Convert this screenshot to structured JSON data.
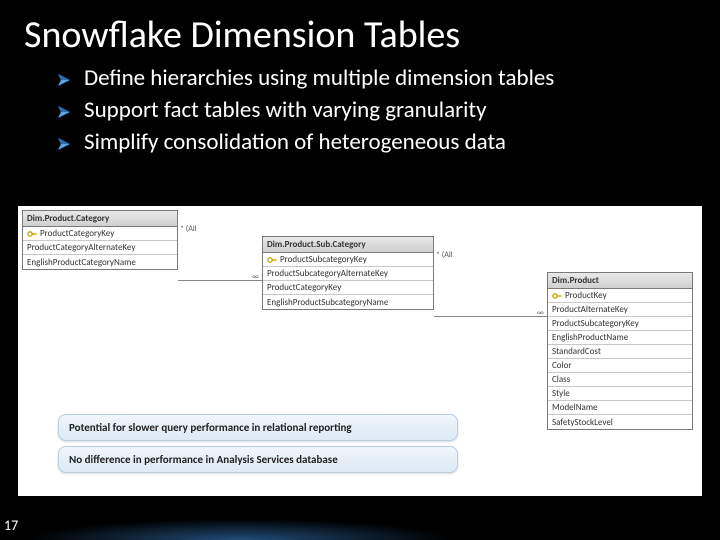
{
  "title": "Snowflake Dimension Tables",
  "bullets": [
    "Define hierarchies using multiple dimension tables",
    "Support fact tables with varying granularity",
    "Simplify consolidation of heterogeneous data"
  ],
  "tables": {
    "category": {
      "title": "Dim.Product.Category",
      "rows": [
        "ProductCategoryKey",
        "ProductCategoryAlternateKey",
        "EnglishProductCategoryName"
      ]
    },
    "subcategory": {
      "title": "Dim.Product.Sub.Category",
      "rows": [
        "ProductSubcategoryKey",
        "ProductSubcategoryAlternateKey",
        "ProductCategoryKey",
        "EnglishProductSubcategoryName"
      ]
    },
    "product": {
      "title": "Dim.Product",
      "rows": [
        "ProductKey",
        "ProductAlternateKey",
        "ProductSubcategoryKey",
        "EnglishProductName",
        "StandardCost",
        "Color",
        "Class",
        "Style",
        "ModelName",
        "SafetyStockLevel"
      ]
    }
  },
  "all_label": "* (All",
  "callouts": {
    "a": "Potential for slower query performance in relational reporting",
    "b": "No difference in performance in Analysis Services database"
  },
  "page": "17",
  "connector_end": "∞"
}
